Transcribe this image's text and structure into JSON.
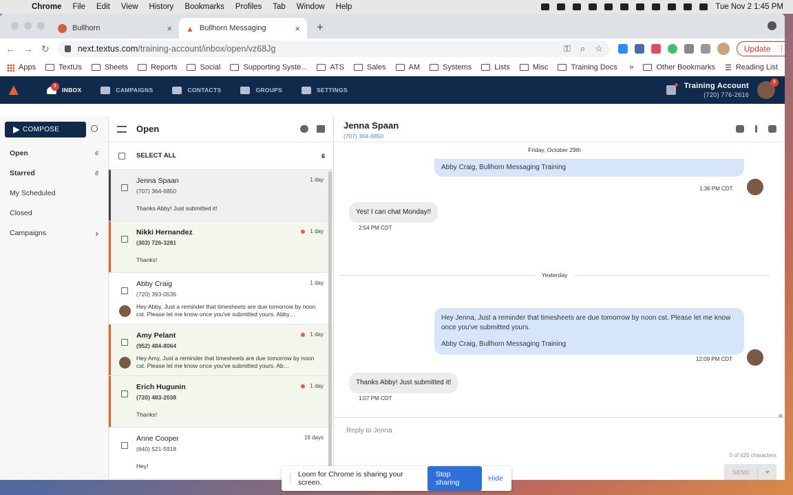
{
  "menubar": {
    "app": "Chrome",
    "items": [
      "File",
      "Edit",
      "View",
      "History",
      "Bookmarks",
      "Profiles",
      "Tab",
      "Window",
      "Help"
    ],
    "clock": "Tue Nov 2  1:45 PM"
  },
  "browser": {
    "tabs": [
      {
        "title": "Bullhorn"
      },
      {
        "title": "Bullhorn Messaging"
      }
    ],
    "url_host": "next.textus.com",
    "url_path": "/training-account/inbox/open/vz68Jg",
    "update_label": "Update",
    "bookmarks": [
      "Apps",
      "TextUs",
      "Sheets",
      "Reports",
      "Social",
      "Supporting Syste...",
      "ATS",
      "Sales",
      "AM",
      "Systems",
      "Lists",
      "Misc",
      "Training Docs"
    ],
    "other_bookmarks": "Other Bookmarks",
    "reading_list": "Reading List"
  },
  "app": {
    "nav": [
      "INBOX",
      "CAMPAIGNS",
      "CONTACTS",
      "GROUPS",
      "SETTINGS"
    ],
    "inbox_badge": "3",
    "account_name": "Training Account",
    "account_phone": "(720) 776-2616",
    "avatar_badge": "3"
  },
  "sidebar": {
    "compose": "COMPOSE",
    "items": [
      {
        "label": "Open",
        "count": "6"
      },
      {
        "label": "Starred",
        "count": "8"
      },
      {
        "label": "My Scheduled",
        "count": ""
      },
      {
        "label": "Closed",
        "count": ""
      },
      {
        "label": "Campaigns",
        "count": "›"
      }
    ]
  },
  "list": {
    "title": "Open",
    "select_all": "SELECT ALL",
    "count": "6",
    "rows": [
      {
        "name": "Jenna Spaan",
        "phone": "(707) 364-6850",
        "time": "1 day",
        "preview": "Thanks Abby! Just submitted it!"
      },
      {
        "name": "Nikki Hernandez",
        "phone": "(303) 726-3281",
        "time": "1 day",
        "preview": "Thanks!"
      },
      {
        "name": "Abby Craig",
        "phone": "(720) 393-0536",
        "time": "1 day",
        "preview": "Hey Abby, Just a reminder that timesheets are due tomorrow by noon cst. Please let me know once you've submitted yours. Abby…"
      },
      {
        "name": "Amy Pelant",
        "phone": "(952) 484-8064",
        "time": "1 day",
        "preview": "Hey Amy, Just a reminder that timesheets are due tomorrow by noon cst. Please let me know once you've submitted yours. Ab…"
      },
      {
        "name": "Erich Hugunin",
        "phone": "(720) 483-2038",
        "time": "1 day",
        "preview": "Thanks!"
      },
      {
        "name": "Anne Cooper",
        "phone": "(640) 521-5918",
        "time": "19 days",
        "preview": "Hey!"
      }
    ]
  },
  "thread": {
    "name": "Jenna Spaan",
    "phone": "(707) 364-6850",
    "date1": "Friday, October 29th",
    "msg1": "Abby Craig, Bullhorn Messaging Training",
    "time1": "1:36 PM CDT",
    "msg2": "Yes! I can chat Monday!!",
    "time2": "2:54 PM CDT",
    "date2": "Yesterday",
    "msg3a": "Hey Jenna, Just a reminder that timesheets are due tomorrow by noon cst. Please let me know once you've submitted yours.",
    "msg3b": "Abby Craig, Bullhorn Messaging Training",
    "time3": "12:09 PM CDT",
    "msg4": "Thanks Abby! Just submitted it!",
    "time4": "1:07 PM CDT",
    "reply_placeholder": "Reply to Jenna",
    "char_count": "0 of 420 characters",
    "send": "SEND"
  },
  "loom": {
    "text": "Loom for Chrome is sharing your screen.",
    "stop": "Stop sharing",
    "hide": "Hide"
  }
}
